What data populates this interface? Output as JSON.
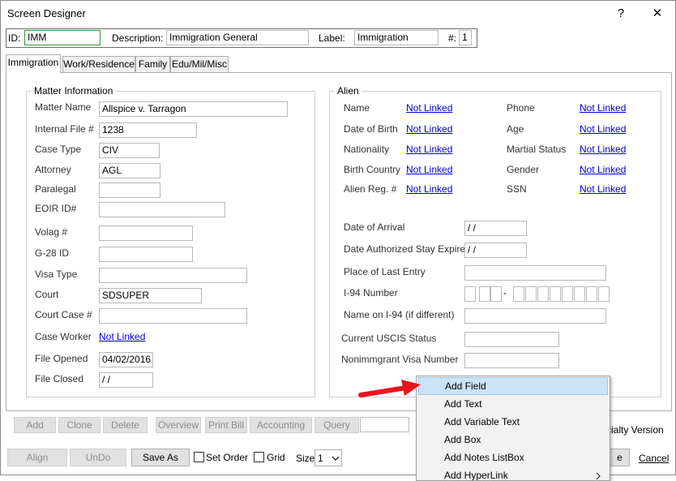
{
  "window": {
    "title": "Screen Designer",
    "help_glyph": "?",
    "close_glyph": "✕"
  },
  "header": {
    "id_label": "ID:",
    "id_value": "IMM",
    "desc_label": "Description:",
    "desc_value": "Immigration General",
    "label_label": "Label:",
    "label_value": "Immigration",
    "num_label": "#:",
    "num_value": "1"
  },
  "tabs": [
    "Immigration",
    "Work/Residence",
    "Family",
    "Edu/Mil/Misc"
  ],
  "matter": {
    "title": "Matter Information",
    "name_label": "Matter Name",
    "name_value": "Allspice v. Tarragon",
    "file_label": "Internal File #",
    "file_value": "1238",
    "case_type_label": "Case Type",
    "case_type_value": "CIV",
    "attorney_label": "Attorney",
    "attorney_value": "AGL",
    "paralegal_label": "Paralegal",
    "paralegal_value": "",
    "eoir_label": "EOIR ID#",
    "eoir_value": "",
    "volag_label": "Volag #",
    "volag_value": "",
    "g28_label": "G-28 ID",
    "g28_value": "",
    "visa_type_label": "Visa Type",
    "visa_type_value": "",
    "court_label": "Court",
    "court_value": "SDSUPER",
    "court_case_label": "Court Case #",
    "court_case_value": "",
    "case_worker_label": "Case Worker",
    "case_worker_link": "Not Linked",
    "file_opened_label": "File Opened",
    "file_opened_value": "04/02/2016",
    "file_closed_label": "File Closed",
    "file_closed_value": " / /"
  },
  "alien": {
    "title": "Alien",
    "name_label": "Name",
    "name_link": "Not Linked",
    "dob_label": "Date of Birth",
    "dob_link": "Not Linked",
    "nationality_label": "Nationality",
    "nationality_link": "Not Linked",
    "birth_country_label": "Birth Country",
    "birth_country_link": "Not Linked",
    "reg_label": "Alien Reg. #",
    "reg_link": "Not Linked",
    "phone_label": "Phone",
    "phone_link": "Not Linked",
    "age_label": "Age",
    "age_link": "Not Linked",
    "marital_label": "Martial Status",
    "marital_link": "Not Linked",
    "gender_label": "Gender",
    "gender_link": "Not Linked",
    "ssn_label": "SSN",
    "ssn_link": "Not Linked",
    "arrival_label": "Date of Arrival",
    "arrival_value": " / /",
    "authorized_label": "Date Authorized Stay Expires",
    "authorized_value": " / /",
    "last_entry_label": "Place of Last Entry",
    "last_entry_value": "",
    "i94_label": "I-94 Number",
    "i94_dash": "-",
    "i94_name_label": "Name on I-94 (if different)",
    "i94_name_value": "",
    "uscis_label": "Current USCIS Status",
    "uscis_value": "",
    "visa_number_label": "Nonimmgrant Visa Number",
    "visa_number_value": ""
  },
  "toolbar": {
    "add": "Add",
    "clone": "Clone",
    "delete": "Delete",
    "overview": "Overview",
    "print_bill": "Print Bill",
    "accounting": "Accounting",
    "query": "Query",
    "specialty_version": "cialty Version"
  },
  "bottom": {
    "align": "Align",
    "undo": "UnDo",
    "save_as": "Save As",
    "set_order": "Set Order",
    "grid": "Grid",
    "size_label": "Size",
    "size_value": "1",
    "ok_partial": "e",
    "cancel": "Cancel"
  },
  "context_menu": {
    "items": [
      "Add Field",
      "Add Text",
      "Add Variable Text",
      "Add Box",
      "Add Notes ListBox",
      "Add HyperLink"
    ],
    "highlighted": "Add Field"
  },
  "colors": {
    "annotation_arrow": "#e8141c",
    "link": "#0000cc",
    "menu_highlight": "#cce4f7"
  }
}
